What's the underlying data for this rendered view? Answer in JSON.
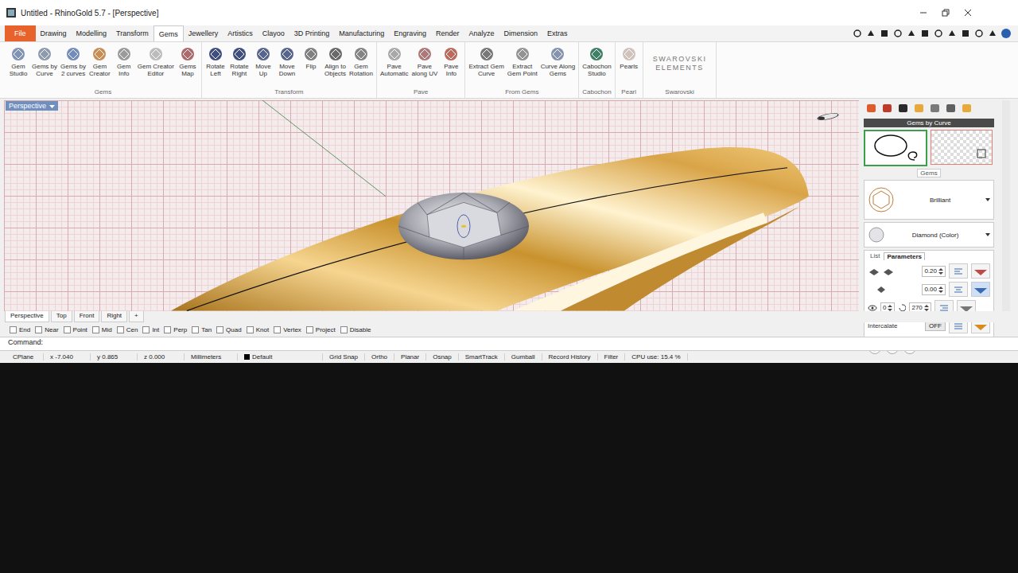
{
  "window": {
    "title": "Untitled - RhinoGold 5.7 - [Perspective]"
  },
  "menu_tabs": [
    {
      "label": "File",
      "selected": false,
      "kind": "file"
    },
    {
      "label": "Drawing",
      "selected": false,
      "kind": "tab"
    },
    {
      "label": "Modelling",
      "selected": false,
      "kind": "tab"
    },
    {
      "label": "Transform",
      "selected": false,
      "kind": "tab"
    },
    {
      "label": "Gems",
      "selected": true,
      "kind": "tab"
    },
    {
      "label": "Jewellery",
      "selected": false,
      "kind": "tab"
    },
    {
      "label": "Artistics",
      "selected": false,
      "kind": "tab"
    },
    {
      "label": "Clayoo",
      "selected": false,
      "kind": "tab"
    },
    {
      "label": "3D Printing",
      "selected": false,
      "kind": "tab"
    },
    {
      "label": "Manufacturing",
      "selected": false,
      "kind": "tab"
    },
    {
      "label": "Engraving",
      "selected": false,
      "kind": "tab"
    },
    {
      "label": "Render",
      "selected": false,
      "kind": "tab"
    },
    {
      "label": "Analyze",
      "selected": false,
      "kind": "tab"
    },
    {
      "label": "Dimension",
      "selected": false,
      "kind": "tab"
    },
    {
      "label": "Extras",
      "selected": false,
      "kind": "tab"
    }
  ],
  "ribbon_groups": [
    {
      "label": "Gems",
      "buttons": [
        {
          "lines": [
            "Gem",
            "Studio"
          ],
          "color": "#6a7fa8"
        },
        {
          "lines": [
            "Gems by",
            "Curve"
          ],
          "color": "#7a8aa0"
        },
        {
          "lines": [
            "Gems by",
            "2 curves"
          ],
          "color": "#5a78b0"
        },
        {
          "lines": [
            "Gem",
            "Creator"
          ],
          "color": "#c07a3a"
        },
        {
          "lines": [
            "Gem",
            "Info"
          ],
          "color": "#8a8a8a"
        },
        {
          "lines": [
            "Gem Creator",
            "Editor"
          ],
          "color": "#b0b0b0"
        },
        {
          "lines": [
            "Gems",
            "Map"
          ],
          "color": "#a05050"
        }
      ]
    },
    {
      "label": "Transform",
      "buttons": [
        {
          "lines": [
            "Rotate",
            "Left"
          ],
          "color": "#1f2f6a"
        },
        {
          "lines": [
            "Rotate",
            "Right"
          ],
          "color": "#1f2f6a"
        },
        {
          "lines": [
            "Move",
            "Up"
          ],
          "color": "#3a4a7a"
        },
        {
          "lines": [
            "Move",
            "Down"
          ],
          "color": "#3a4a7a"
        },
        {
          "lines": [
            "Flip"
          ],
          "color": "#6a6a6a"
        },
        {
          "lines": [
            "Align to",
            "Objects"
          ],
          "color": "#505050"
        },
        {
          "lines": [
            "Gem",
            "Rotation"
          ],
          "color": "#707070"
        }
      ]
    },
    {
      "label": "Pave",
      "buttons": [
        {
          "lines": [
            "Pave",
            "Automatic"
          ],
          "color": "#9a9a9a"
        },
        {
          "lines": [
            "Pave",
            "along UV"
          ],
          "color": "#a06060"
        },
        {
          "lines": [
            "Pave",
            "Info"
          ],
          "color": "#b05040"
        }
      ]
    },
    {
      "label": "From Gems",
      "buttons": [
        {
          "lines": [
            "Extract Gem",
            "Curve"
          ],
          "color": "#606060"
        },
        {
          "lines": [
            "Extract",
            "Gem Point"
          ],
          "color": "#808080"
        },
        {
          "lines": [
            "Curve Along",
            "Gems"
          ],
          "color": "#7080a0"
        }
      ]
    },
    {
      "label": "Cabochon",
      "buttons": [
        {
          "lines": [
            "Cabochon",
            "Studio"
          ],
          "color": "#1e6a4a"
        }
      ]
    },
    {
      "label": "Pearl",
      "buttons": [
        {
          "lines": [
            "Pearls"
          ],
          "color": "#c8b8b0"
        }
      ]
    },
    {
      "label": "Swarovski",
      "buttons": []
    }
  ],
  "swarovski_logo": [
    "SWAROVSKI",
    "ELEMENTS"
  ],
  "viewport": {
    "label": "Perspective"
  },
  "panel": {
    "header": "Gems by Curve",
    "gems_label": "Gems",
    "cut": "Brilliant",
    "material": "Diamond (Color)",
    "tabs": [
      {
        "label": "List",
        "selected": false
      },
      {
        "label": "Parameters",
        "selected": true
      }
    ],
    "height": "0.20",
    "depth": "0.00",
    "offset": "0",
    "angle": "270",
    "intercalate": {
      "label": "Intercalate",
      "value": "OFF",
      "on": false
    },
    "help": "?"
  },
  "view_tabs": [
    {
      "label": "Perspective",
      "selected": true
    },
    {
      "label": "Top",
      "selected": false
    },
    {
      "label": "Front",
      "selected": false
    },
    {
      "label": "Right",
      "selected": false
    }
  ],
  "add_view": "+",
  "osnaps": [
    {
      "label": "End",
      "checked": false
    },
    {
      "label": "Near",
      "checked": false
    },
    {
      "label": "Point",
      "checked": false
    },
    {
      "label": "Mid",
      "checked": false
    },
    {
      "label": "Cen",
      "checked": false
    },
    {
      "label": "Int",
      "checked": false
    },
    {
      "label": "Perp",
      "checked": false
    },
    {
      "label": "Tan",
      "checked": false
    },
    {
      "label": "Quad",
      "checked": false
    },
    {
      "label": "Knot",
      "checked": false
    },
    {
      "label": "Vertex",
      "checked": false
    },
    {
      "label": "Project",
      "checked": false
    },
    {
      "label": "Disable",
      "checked": false
    }
  ],
  "command": {
    "label": "Command:"
  },
  "status_bar": {
    "cplane": "CPlane",
    "x": "x -7.040",
    "y": "y 0.865",
    "z": "z 0.000",
    "units": "Millimeters",
    "layer": "Default",
    "toggles": [
      "Grid Snap",
      "Ortho",
      "Planar",
      "Osnap",
      "SmartTrack",
      "Gumball",
      "Record History",
      "Filter"
    ],
    "cpu": "CPU use: 15.4 %"
  }
}
